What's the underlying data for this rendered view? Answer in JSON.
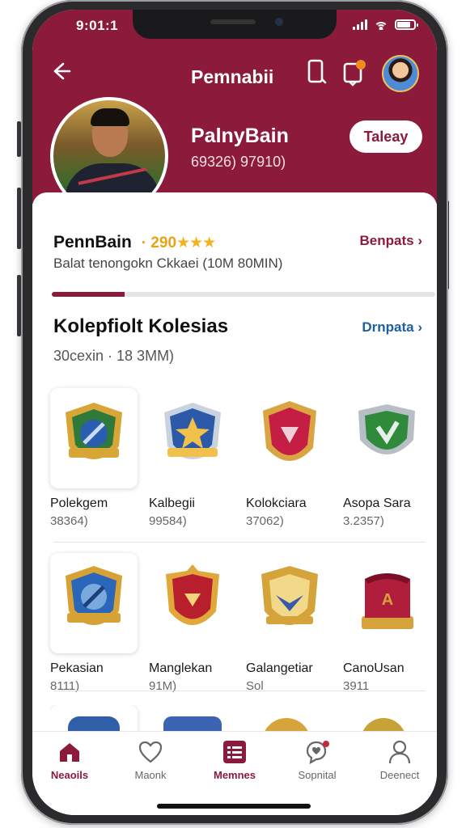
{
  "status": {
    "time": "9:01:1"
  },
  "header": {
    "title": "Pemnabii"
  },
  "profile": {
    "name": "PalnyBain",
    "subtitle": "69326) 97910)",
    "follow_label": "Taleay"
  },
  "rating": {
    "name": "PennBain",
    "score": "· 290",
    "stars": "★★★",
    "subtitle": "Balat tenongokn Ckkaei (10M 80MIN)",
    "reports_label": "Benpats ›",
    "progress_fraction": 0.19
  },
  "collection": {
    "title": "Kolepfiolt Kolesias",
    "link_label": "Drnpata ›",
    "subtitle": "30cexin · 18 3MM)",
    "items": [
      {
        "name": "Polekgem",
        "meta": "38364)",
        "badge": "gold-cross-shield",
        "colors": [
          "#2f7a3a",
          "#d8a537",
          "#2a5cb0"
        ]
      },
      {
        "name": "Kalbegii",
        "meta": "99584)",
        "badge": "star-shield",
        "colors": [
          "#2c5aa8",
          "#c9d3df",
          "#f2c14b"
        ]
      },
      {
        "name": "Kolokciara",
        "meta": "37062)",
        "badge": "crimson-crest",
        "colors": [
          "#c41e45",
          "#d9a441",
          "#f0d0d8"
        ]
      },
      {
        "name": "Asopa Sara",
        "meta": "3.2357)",
        "badge": "green-crest",
        "colors": [
          "#2f8a3c",
          "#b8bec6",
          "#e6f0e8"
        ]
      },
      {
        "name": "Pekasian",
        "meta": "8111)",
        "badge": "blue-gold-shield",
        "colors": [
          "#2b66b8",
          "#d6a236",
          "#7aa9e0"
        ]
      },
      {
        "name": "Manglekan",
        "meta": "91M)",
        "badge": "red-gold-crest",
        "colors": [
          "#b81f2c",
          "#e0a73a",
          "#f4d27a"
        ]
      },
      {
        "name": "Galangetiar",
        "meta": "Sol",
        "badge": "gold-crest",
        "colors": [
          "#d4a43a",
          "#3a5aa8",
          "#f2d98a"
        ]
      },
      {
        "name": "CanoUsan",
        "meta": "3911",
        "badge": "crimson-cube",
        "colors": [
          "#b01e3c",
          "#d6a33a",
          "#ffffff"
        ]
      }
    ]
  },
  "nav": {
    "items": [
      {
        "label": "Neaoils",
        "icon": "home-icon",
        "active": true
      },
      {
        "label": "Maonk",
        "icon": "heart-icon",
        "active": false
      },
      {
        "label": "Memnes",
        "icon": "list-icon",
        "active": true
      },
      {
        "label": "Sopnital",
        "icon": "chat-heart-icon",
        "active": false
      },
      {
        "label": "Deenect",
        "icon": "user-icon",
        "active": false
      }
    ]
  },
  "theme": {
    "primary": "#8c1a3a",
    "accent": "#f2b21c",
    "link": "#1d5fa0"
  }
}
